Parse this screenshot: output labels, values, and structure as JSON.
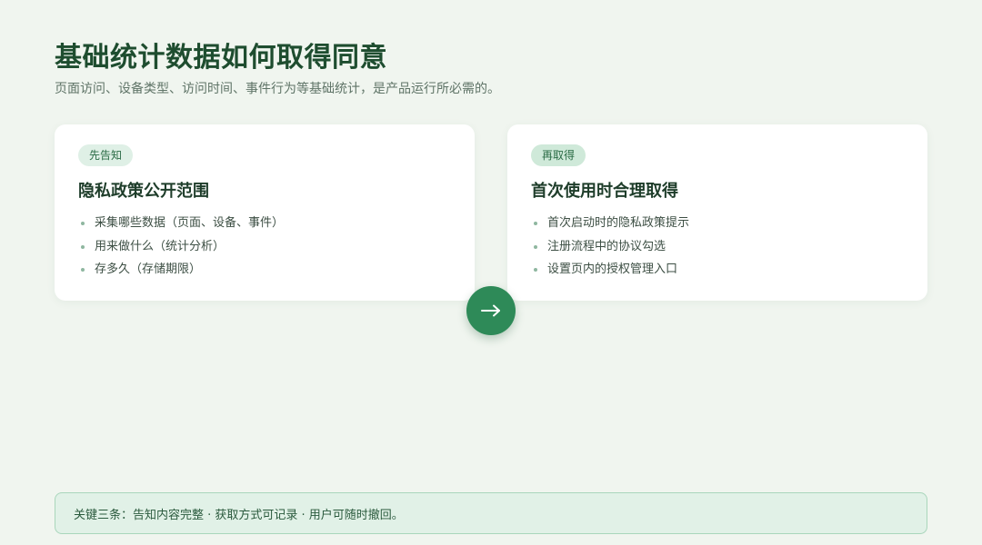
{
  "page": {
    "title": "基础统计数据如何取得同意",
    "subtitle": "页面访问、设备类型、访问时间、事件行为等基础统计，是产品运行所必需的。"
  },
  "cards": [
    {
      "badge": "先告知",
      "title": "隐私政策公开范围",
      "items": [
        "采集哪些数据（页面、设备、事件）",
        "用来做什么（统计分析）",
        "存多久（存储期限）"
      ]
    },
    {
      "badge": "再取得",
      "title": "首次使用时合理取得",
      "items": [
        "首次启动时的隐私政策提示",
        "注册流程中的协议勾选",
        "设置页内的授权管理入口"
      ]
    }
  ],
  "connector": {
    "icon": "arrow-right-icon"
  },
  "footer": {
    "note": "关键三条：告知内容完整 · 获取方式可记录 · 用户可随时撤回。"
  },
  "colors": {
    "background": "#f0f5ef",
    "accent": "#2e8a58",
    "title": "#1e4d2f",
    "badge_bg": "#dff0e6",
    "note_bg": "#e1f1e7",
    "note_border": "#a9d6bb"
  }
}
